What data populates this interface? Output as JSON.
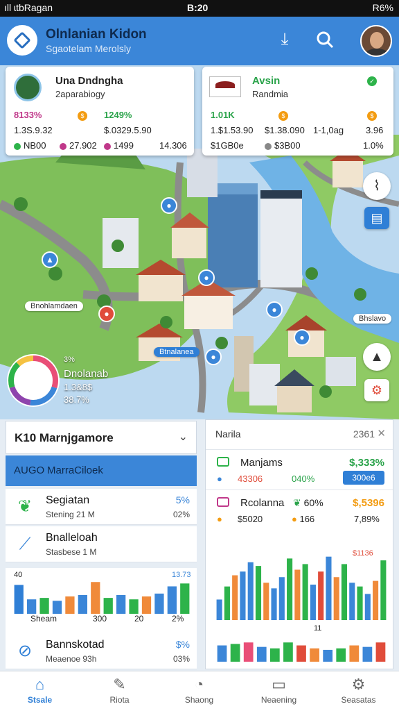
{
  "status_bar": {
    "carrier": "ıll ɩtbRagan",
    "time": "B:20",
    "battery": "R6%"
  },
  "header": {
    "title": "Olnlanian Kidon",
    "subtitle": "Sgaotelam Merolsly",
    "icons": [
      "download-icon",
      "search-icon",
      "avatar"
    ]
  },
  "map": {
    "card_left": {
      "title": "Una Dndngha",
      "subtitle": "2aparabiogy",
      "stat1": "8133%",
      "stat2": "1249%",
      "line1": "1.3S.9.32",
      "line2": "$.0329.5.90",
      "foot1": "NB00",
      "foot2": "27.902",
      "foot3": "1499",
      "foot4": "14.306",
      "colors": {
        "stat1": "#c0388a",
        "stat2": "#2aa34a"
      }
    },
    "card_right": {
      "title": "Avsin",
      "subtitle": "Randmia",
      "stat1": "1.01K",
      "stat2": "1.0,",
      "line1": "1.$1.53.90",
      "line2": "$1.38.090",
      "line3": "1-1,0ag",
      "line4": "3.96",
      "foot1": "$1GB0e",
      "foot2": "$3B00",
      "foot3": "1.0%",
      "colors": {
        "stat1": "#2aa34a",
        "stat2": "#2aa34a"
      }
    },
    "labels": [
      "Bnohlamdaen",
      "Btnalanea",
      "Bhslavo"
    ],
    "donut": {
      "pct": "3%",
      "title": "Dnolanab",
      "value": "1.3&8$",
      "total": "38.7%",
      "segments": [
        {
          "value": 30,
          "color": "#e94e77"
        },
        {
          "value": 22,
          "color": "#3b86d8"
        },
        {
          "value": 18,
          "color": "#8e44ad"
        },
        {
          "value": 18,
          "color": "#2db34a"
        },
        {
          "value": 12,
          "color": "#f5c242"
        }
      ]
    }
  },
  "left_panel": {
    "dropdown_label": "K10 Marnjgamore",
    "banner_code": "AUGO",
    "banner_label": "MarraCiloek",
    "rows": [
      {
        "title": "Segiatan",
        "sub": "Stening 21 M",
        "pct": "5%",
        "pct2": "02%",
        "icon": "leaf-icon"
      },
      {
        "title": "Bnalleloah",
        "sub": "Stasbese 1 M",
        "pct": "",
        "pct2": "",
        "icon": "chart-icon"
      },
      {
        "title": "Bannskotad",
        "sub": "Meaenoe 93h",
        "pct": "$%",
        "pct2": "03%",
        "icon": "search-icon"
      }
    ],
    "chart_labels": {
      "top_left": "40",
      "top_right": "13.73",
      "x": [
        "Sheam",
        "300",
        "20",
        "2%"
      ]
    }
  },
  "right_panel": {
    "title": "Narila",
    "count": "2361",
    "rows": [
      {
        "name": "Manjams",
        "value": "$,333%",
        "sub1": "43306",
        "sub2": "040%",
        "btn": "300e6",
        "value_color": "#2aa34a",
        "sq_color": "#2db34a"
      },
      {
        "name": "Rcolanna",
        "pct": "60%",
        "value": "$,5396",
        "sub1": "$5020",
        "sub2": "166",
        "sub3": "7,89%",
        "value_color": "#f39c12",
        "sq_color": "#c0388a"
      }
    ],
    "chart_top_label": "$1136",
    "chart_mid_label": "11"
  },
  "chart_data": [
    {
      "type": "bar",
      "name": "left-chart",
      "categories": [
        "1",
        "2",
        "3",
        "4",
        "5",
        "6",
        "7",
        "8",
        "9",
        "10",
        "11",
        "12",
        "13",
        "14"
      ],
      "series": [
        {
          "values": [
            40,
            20,
            22,
            18,
            24,
            26,
            44,
            22,
            26,
            20,
            24,
            28,
            38,
            42
          ]
        }
      ],
      "colors": [
        "#2f7fd6",
        "#3b86d8",
        "#2db34a",
        "#3b86d8",
        "#f08a3a",
        "#3b86d8",
        "#f08a3a",
        "#2db34a",
        "#3b86d8",
        "#2db34a",
        "#f08a3a",
        "#3b86d8",
        "#3b86d8",
        "#2db34a"
      ],
      "ylim": [
        0,
        50
      ]
    },
    {
      "type": "bar",
      "name": "right-chart-top",
      "categories": [
        "1",
        "2",
        "3",
        "4",
        "5",
        "6",
        "7",
        "8",
        "9",
        "10",
        "11",
        "12",
        "13",
        "14",
        "15",
        "16",
        "17",
        "18",
        "19",
        "20",
        "21",
        "22"
      ],
      "values": [
        22,
        36,
        48,
        52,
        62,
        58,
        40,
        34,
        46,
        66,
        54,
        60,
        38,
        52,
        68,
        46,
        60,
        40,
        36,
        28,
        42,
        64
      ],
      "colors": [
        "#3b86d8",
        "#2db34a",
        "#f08a3a",
        "#3b86d8",
        "#3b86d8",
        "#2db34a",
        "#f08a3a",
        "#3b86d8",
        "#3b86d8",
        "#2db34a",
        "#f08a3a",
        "#2db34a",
        "#3b86d8",
        "#e04c3a",
        "#3b86d8",
        "#f08a3a",
        "#2db34a",
        "#3b86d8",
        "#2db34a",
        "#3b86d8",
        "#f08a3a",
        "#2db34a"
      ],
      "ylim": [
        0,
        70
      ]
    },
    {
      "type": "bar",
      "name": "right-chart-bottom",
      "categories": [
        "1",
        "2",
        "3",
        "4",
        "5",
        "6",
        "7",
        "8",
        "9",
        "10",
        "11",
        "12",
        "13"
      ],
      "values": [
        22,
        24,
        26,
        20,
        18,
        26,
        22,
        18,
        16,
        18,
        22,
        20,
        26
      ],
      "colors": [
        "#3b86d8",
        "#2db34a",
        "#e94e77",
        "#3b86d8",
        "#2db34a",
        "#2db34a",
        "#e04c3a",
        "#f08a3a",
        "#3b86d8",
        "#2db34a",
        "#f08a3a",
        "#3b86d8",
        "#e04c3a"
      ],
      "ylim": [
        0,
        30
      ]
    }
  ],
  "bottom_nav": [
    {
      "label": "Stsale",
      "icon": "home-icon",
      "active": true
    },
    {
      "label": "Riota",
      "icon": "edit-icon",
      "active": false
    },
    {
      "label": "Shaong",
      "icon": "speed-icon",
      "active": false
    },
    {
      "label": "Neaening",
      "icon": "monitor-icon",
      "active": false
    },
    {
      "label": "Seasatas",
      "icon": "settings-icon",
      "active": false
    }
  ]
}
